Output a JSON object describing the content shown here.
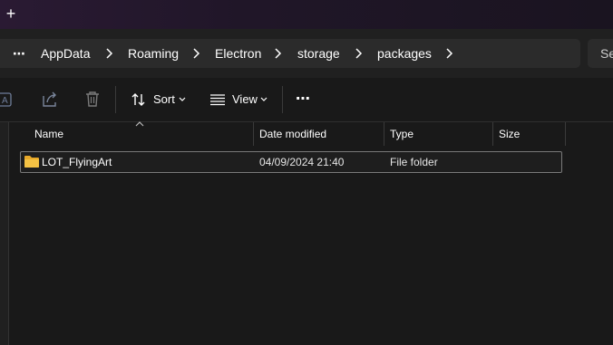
{
  "titlebar": {
    "new_tab_label": "+"
  },
  "breadcrumb": {
    "more_label": "⋯",
    "items": [
      "AppData",
      "Roaming",
      "Electron",
      "storage",
      "packages"
    ]
  },
  "search": {
    "label": "Se"
  },
  "toolbar": {
    "sort_label": "Sort",
    "view_label": "View",
    "more_label": "⋯"
  },
  "columns": {
    "name": "Name",
    "date": "Date modified",
    "type": "Type",
    "size": "Size"
  },
  "files": [
    {
      "name": "LOT_FlyingArt",
      "date": "04/09/2024 21:40",
      "type": "File folder",
      "size": ""
    }
  ],
  "colors": {
    "accent_folder": "#f4c244",
    "background": "#191919",
    "bar": "#2b2b2b"
  }
}
